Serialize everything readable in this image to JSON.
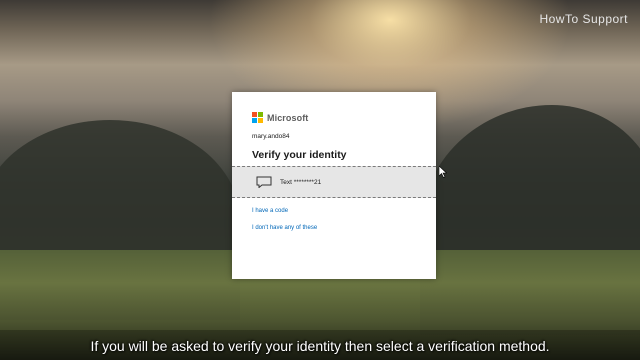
{
  "watermark": "HowTo Support",
  "dialog": {
    "brand": "Microsoft",
    "brand_colors": [
      "#f25022",
      "#7fba00",
      "#00a4ef",
      "#ffb900"
    ],
    "account": "mary.ando84",
    "title": "Verify your identity",
    "option": {
      "icon": "chat-bubble-icon",
      "label": "Text ********21"
    },
    "links": {
      "have_code": "I have a code",
      "none": "I don't have any of these"
    }
  },
  "caption": "If you will be asked to verify your identity then select a verification method."
}
